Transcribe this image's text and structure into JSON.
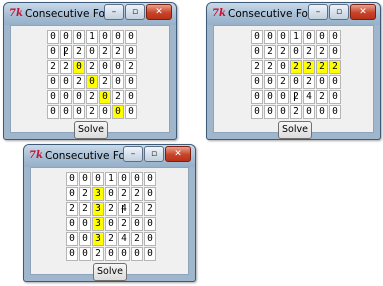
{
  "windows": [
    {
      "title": "Consecutive Four",
      "solve_label": "Solve",
      "highlight_color": "#ffff00",
      "caret_cell": [
        1,
        1
      ],
      "grid": [
        [
          "0",
          "0",
          "0",
          "1",
          "0",
          "0",
          "0"
        ],
        [
          "0",
          "2",
          "2",
          "0",
          "2",
          "2",
          "0"
        ],
        [
          "2",
          "2",
          "0",
          "2",
          "0",
          "0",
          "2"
        ],
        [
          "0",
          "0",
          "2",
          "0",
          "2",
          "0",
          "0"
        ],
        [
          "0",
          "0",
          "0",
          "2",
          "0",
          "2",
          "0"
        ],
        [
          "0",
          "0",
          "0",
          "2",
          "0",
          "0",
          "0"
        ]
      ],
      "highlighted": [
        [
          2,
          2
        ],
        [
          3,
          3
        ],
        [
          4,
          4
        ],
        [
          5,
          5
        ]
      ]
    },
    {
      "title": "Consecutive Four",
      "solve_label": "Solve",
      "highlight_color": "#ffff00",
      "caret_cell": [
        4,
        3
      ],
      "grid": [
        [
          "0",
          "0",
          "0",
          "1",
          "0",
          "0",
          "0"
        ],
        [
          "0",
          "2",
          "2",
          "0",
          "2",
          "2",
          "0"
        ],
        [
          "2",
          "2",
          "0",
          "2",
          "2",
          "2",
          "2"
        ],
        [
          "0",
          "0",
          "2",
          "0",
          "2",
          "0",
          "0"
        ],
        [
          "0",
          "0",
          "0",
          "2",
          "4",
          "2",
          "0"
        ],
        [
          "0",
          "0",
          "0",
          "2",
          "0",
          "0",
          "0"
        ]
      ],
      "highlighted": [
        [
          2,
          3
        ],
        [
          2,
          4
        ],
        [
          2,
          5
        ],
        [
          2,
          6
        ]
      ]
    },
    {
      "title": "Consecutive Four",
      "solve_label": "Solve",
      "highlight_color": "#ffff00",
      "caret_cell": [
        2,
        4
      ],
      "grid": [
        [
          "0",
          "0",
          "0",
          "1",
          "0",
          "0",
          "0"
        ],
        [
          "0",
          "2",
          "3",
          "0",
          "2",
          "2",
          "0"
        ],
        [
          "2",
          "2",
          "3",
          "2",
          "4",
          "2",
          "2"
        ],
        [
          "0",
          "0",
          "3",
          "0",
          "2",
          "0",
          "0"
        ],
        [
          "0",
          "0",
          "3",
          "2",
          "4",
          "2",
          "0"
        ],
        [
          "0",
          "0",
          "2",
          "0",
          "0",
          "0",
          "0"
        ]
      ],
      "highlighted": [
        [
          1,
          2
        ],
        [
          2,
          2
        ],
        [
          3,
          2
        ],
        [
          4,
          2
        ]
      ]
    }
  ]
}
